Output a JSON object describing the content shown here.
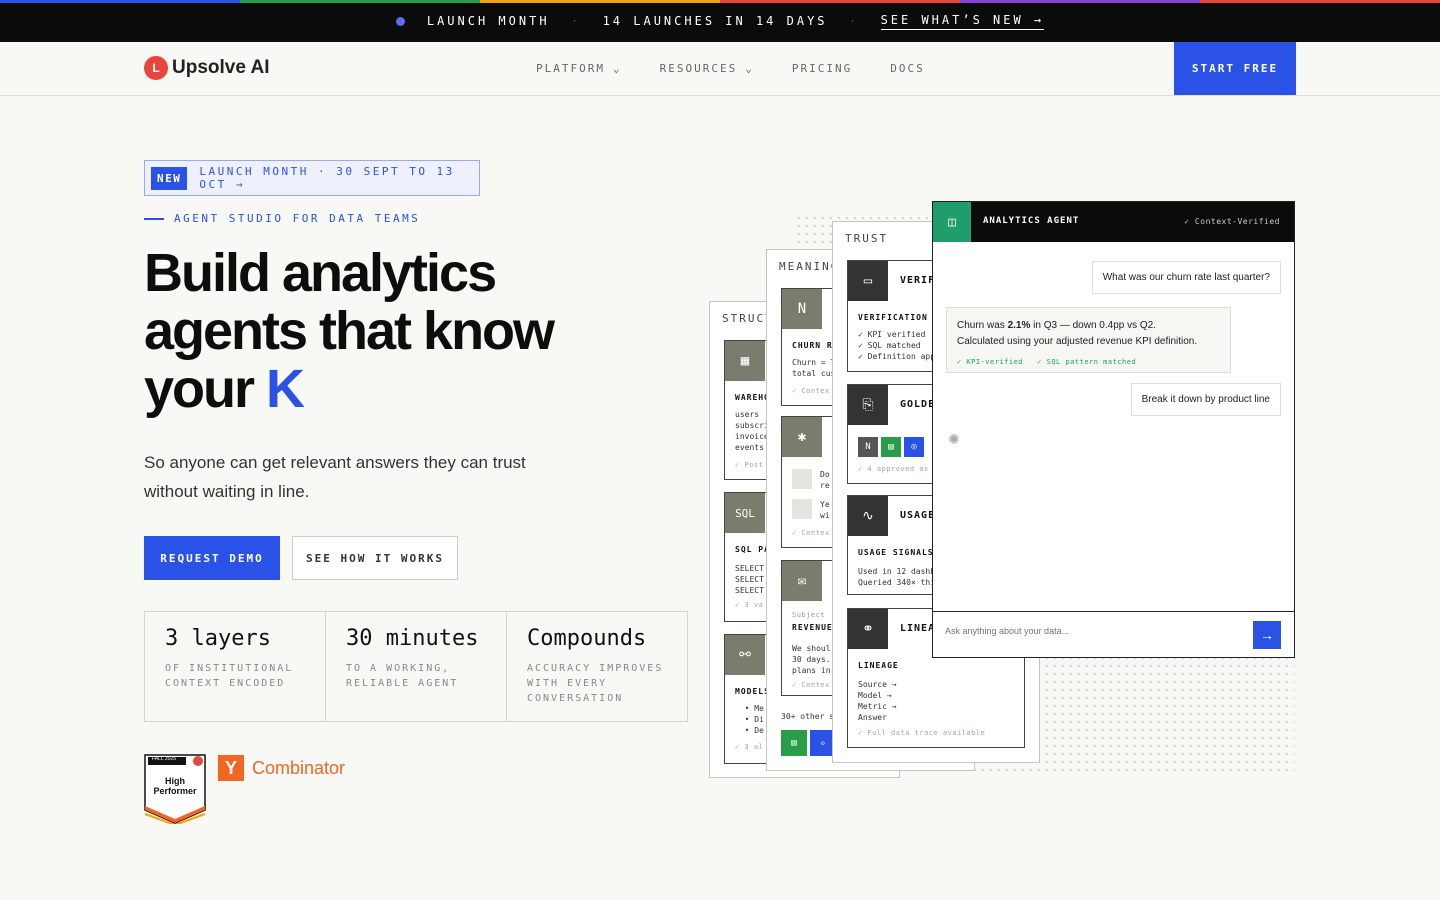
{
  "colors": {
    "accent": "#2a52e6",
    "green": "#1f9d6b",
    "topbar_stripes": [
      "#2a52e6",
      "#2a9d4a",
      "#f2a20c",
      "#e8453c",
      "#8b3fd9",
      "#e8453c"
    ]
  },
  "topbar": {
    "item1": "LAUNCH MONTH",
    "item2": "14 LAUNCHES IN 14 DAYS",
    "cta": "SEE WHAT’S NEW →",
    "sep": "·"
  },
  "nav": {
    "logo": "Upsolve AI",
    "items": [
      "PLATFORM",
      "RESOURCES",
      "PRICING",
      "DOCS"
    ],
    "start": "START FREE"
  },
  "hero": {
    "badge_new": "NEW",
    "badge_text": "LAUNCH MONTH · 30 SEPT TO 13 OCT →",
    "eyebrow": "AGENT STUDIO FOR DATA TEAMS",
    "title_1": "Build analytics",
    "title_2": "agents that know",
    "title_3": "your",
    "title_k": "K",
    "subtitle": "So anyone can get relevant answers they can trust without waiting in line.",
    "btn_demo": "REQUEST DEMO",
    "btn_how": "SEE HOW IT WORKS"
  },
  "stats": [
    {
      "big": "3 layers",
      "small": "OF INSTITUTIONAL CONTEXT ENCODED"
    },
    {
      "big": "30 minutes",
      "small": "TO A WORKING, RELIABLE AGENT"
    },
    {
      "big": "Compounds",
      "small": "ACCURACY IMPROVES WITH EVERY CONVERSATION"
    }
  ],
  "badges": {
    "g2_top": "FALL 2025",
    "g2_main": "High Performer",
    "yc": "Combinator",
    "yc_letter": "Y"
  },
  "cards": {
    "structure": {
      "head": "STRUCT",
      "warehouse": "WAREHO",
      "wh_body": "users\nsubscri\ninvoice\nevents",
      "wh_foot": "✓ Post",
      "sql_label": "SQL PA",
      "sql_body": "SELECT\nSELECT\nSELECT",
      "sql_foot": "✓ 3 va",
      "models": "MODELS",
      "models_body": "  • Me\n  • Di\n  • De",
      "models_foot": "✓ 3 al"
    },
    "meaning": {
      "head": "MEANING",
      "churn": "CHURN RA",
      "churn_body": "Churn = T\ntotal cus",
      "churn_foot": "✓ Contex",
      "slack_body": "Do\nre",
      "slack_body2": "Ye\nwi",
      "slack_foot": "✓ Contex",
      "mail_sub": "Subject",
      "mail_lbl": "REVENUE",
      "mail_body": "We shoul\n30 days.\nplans in",
      "mail_foot": "✓ Contex",
      "other": "30+ other s"
    },
    "trust": {
      "head": "TRUST",
      "verif": "VERIF",
      "verif_lbl": "VERIFICATION",
      "verif_body": "✓ KPI verified\n✓ SQL matched\n✓ Definition app",
      "golden": "GOLDE",
      "golden_foot": "✓ 4 approved as",
      "usage": "USAGE",
      "usage_lbl": "USAGE SIGNALS",
      "usage_body": "Used in 12 dashb\nQueried 340× thi",
      "lineage": "LINEA",
      "lineage_lbl": "LINEAGE",
      "lineage_body": "Source →\nModel →\nMetric →\nAnswer",
      "lineage_foot": "✓ Full data trace available"
    }
  },
  "agent": {
    "title": "ANALYTICS AGENT",
    "verified": "✓ Context-Verified",
    "q1": "What was our churn rate last quarter?",
    "a1_pre": "Churn was ",
    "a1_bold": "2.1%",
    "a1_post": " in Q3 — down 0.4pp vs Q2.",
    "a1_line2": "Calculated using your adjusted revenue KPI definition.",
    "a1_chk1": "✓ KPI-verified",
    "a1_chk2": "✓ SQL pattern matched",
    "q2": "Break it down by product line",
    "placeholder": "Ask anything about your data..."
  }
}
